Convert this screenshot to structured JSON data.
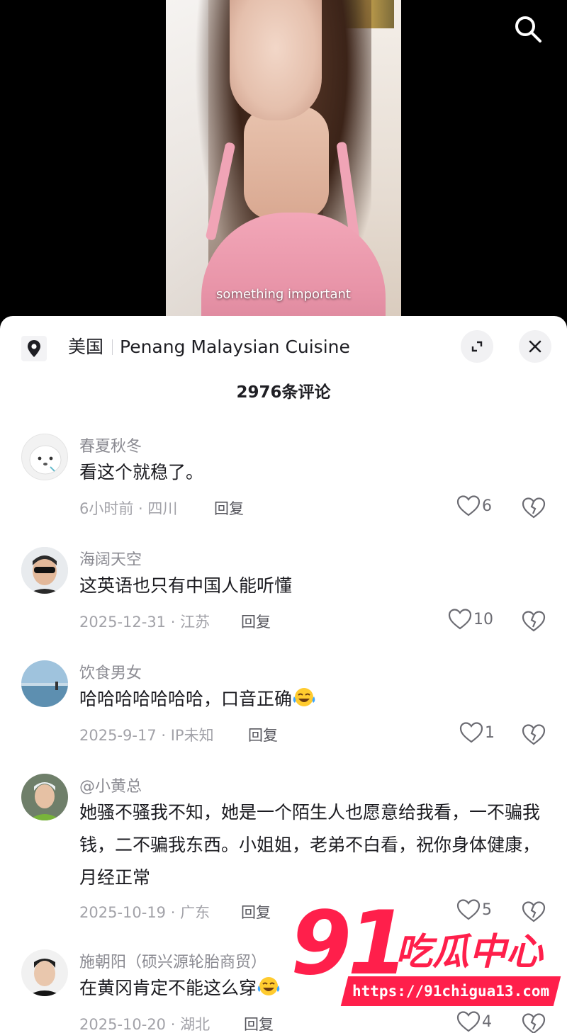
{
  "video": {
    "caption": "something important"
  },
  "location": {
    "region": "美国",
    "place": "Penang Malaysian Cuisine"
  },
  "comments_count": "2976条评论",
  "comments": [
    {
      "user": "春夏秋冬",
      "text": "看这个就稳了。",
      "meta": "6小时前 · 四川",
      "reply": "回复",
      "likes": "6"
    },
    {
      "user": "海阔天空",
      "text": "这英语也只有中国人能听懂",
      "meta": "2025-12-31 · 江苏",
      "reply": "回复",
      "likes": "10"
    },
    {
      "user": "饮食男女",
      "text": "哈哈哈哈哈哈哈，口音正确",
      "meta": "2025-9-17 · IP未知",
      "reply": "回复",
      "likes": "1"
    },
    {
      "user": "@小黄总",
      "text": "她骚不骚我不知，她是一个陌生人也愿意给我看，一不骗我钱，二不骗我东西。小姐姐，老弟不白看，祝你身体健康，月经正常",
      "meta": "2025-10-19 · 广东",
      "reply": "回复",
      "likes": "5"
    },
    {
      "user": "施朝阳（硕兴源轮胎商贸）",
      "text": "在黄冈肯定不能这么穿",
      "meta": "2025-10-20 · 湖北",
      "reply": "回复",
      "likes": "4"
    }
  ],
  "watermark": {
    "number": "91",
    "name": "吃瓜中心",
    "url": "https://91chigua13.com"
  },
  "colors": {
    "watermark": "#ff1f4b",
    "sheet_bg": "#ffffff"
  },
  "icons": [
    "search-icon",
    "location-pin-icon",
    "expand-icon",
    "close-icon",
    "heart-icon",
    "broken-heart-icon",
    "laugh-cry-emoji"
  ]
}
